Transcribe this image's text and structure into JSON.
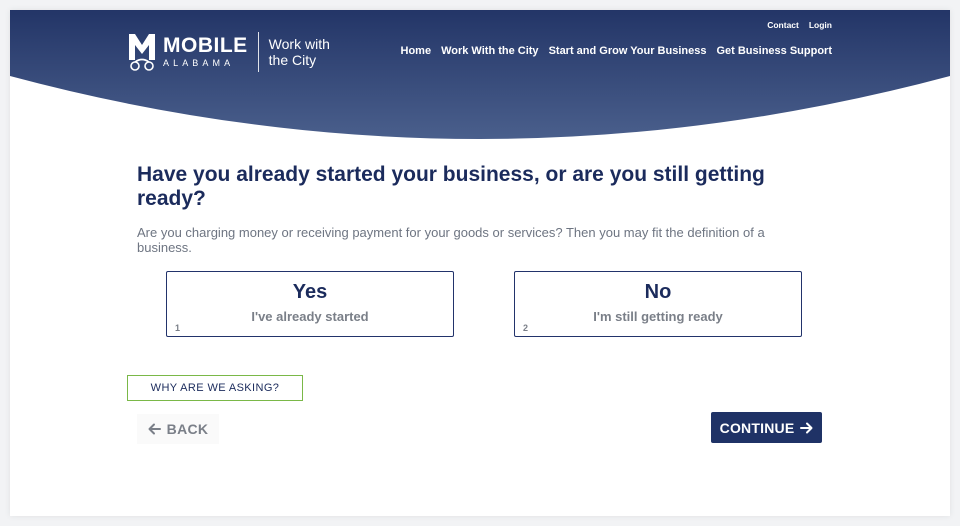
{
  "colors": {
    "header_top": "#233567",
    "header_bottom": "#4a5f8c",
    "heading": "#1b2b5c",
    "muted": "#7a7f88",
    "option_border": "#22336b",
    "why_border": "#7ab848",
    "continue_bg": "#1f3266"
  },
  "header": {
    "logo": {
      "word1": "MOBILE",
      "word2": "ALABAMA",
      "tagline": "Work with the City"
    },
    "utility_nav": [
      "Contact",
      "Login"
    ],
    "main_nav": [
      "Home",
      "Work With the City",
      "Start and Grow Your Business",
      "Get Business Support"
    ]
  },
  "question": {
    "title": "Have you already started your business, or are you still getting ready?",
    "description": "Are you charging money or receiving payment for your goods or services? Then you may fit the definition of a business."
  },
  "options": [
    {
      "title": "Yes",
      "subtitle": "I've already started",
      "key": "1"
    },
    {
      "title": "No",
      "subtitle": "I'm still getting ready",
      "key": "2"
    }
  ],
  "actions": {
    "why": "WHY ARE WE ASKING?",
    "back": "BACK",
    "continue": "CONTINUE"
  },
  "icons": {
    "logo": "mobile-logo-icon",
    "back": "arrow-left-icon",
    "continue": "arrow-right-icon"
  }
}
